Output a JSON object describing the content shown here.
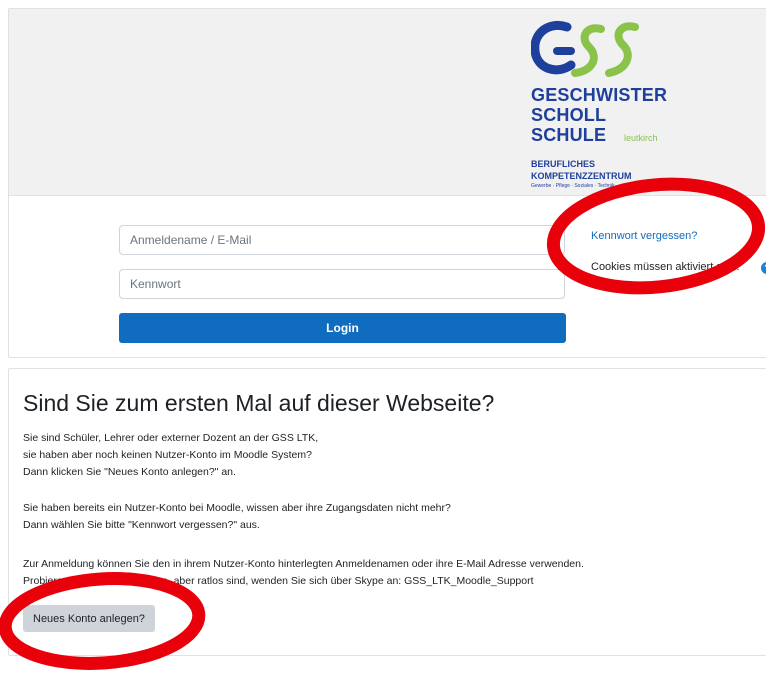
{
  "login": {
    "logo": {
      "line1": "GESCHWISTER",
      "line2": "SCHOLL",
      "line3": "SCHULE",
      "sub": "leutkirch",
      "b1": "BERUFLICHES",
      "b2": "KOMPETENZZENTRUM",
      "b3": "Gewerbe · Pflege · Soziales · Technik"
    },
    "username_placeholder": "Anmeldename / E-Mail",
    "password_placeholder": "Kennwort",
    "login_label": "Login",
    "forgot_label": "Kennwort vergessen?",
    "cookies_text": "Cookies müssen aktiviert sein!",
    "help_glyph": "?"
  },
  "info": {
    "title": "Sind Sie zum ersten Mal auf dieser Webseite?",
    "lines": [
      "Sie sind Schüler, Lehrer oder externer Dozent an der GSS LTK,",
      "sie haben aber noch keinen Nutzer-Konto im Moodle System?",
      "Dann klicken Sie \"Neues Konto anlegen?\" an.",
      "Sie haben bereits ein Nutzer-Konto bei Moodle, wissen aber ihre Zugangsdaten nicht mehr?",
      "Dann wählen Sie bitte \"Kennwort vergessen?\" aus.",
      "Zur Anmeldung können Sie den in ihrem Nutzer-Konto hinterlegten Anmeldenamen oder ihre E-Mail Adresse verwenden.",
      "Probieren alles versucht haben, aber ratlos sind, wenden Sie sich über Skype an: GSS_LTK_Moodle_Support"
    ],
    "new_account_label": "Neues Konto anlegen?"
  },
  "colors": {
    "primary": "#0f6cbf",
    "annotation": "#e8000b",
    "logo_blue": "#1f3f9c",
    "logo_green": "#8bc34a"
  }
}
